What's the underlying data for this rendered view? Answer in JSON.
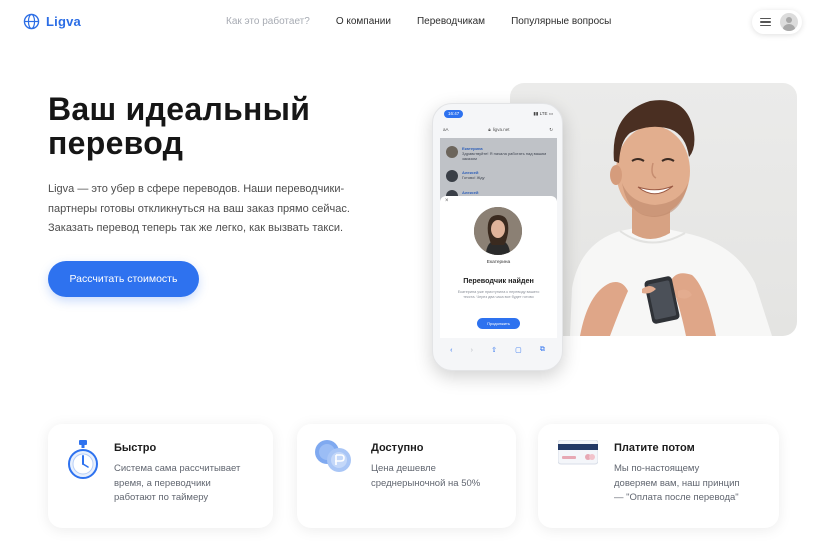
{
  "header": {
    "brand": "Ligva",
    "nav": [
      {
        "label": "Как это работает?",
        "muted": true
      },
      {
        "label": "О компании",
        "muted": false
      },
      {
        "label": "Переводчикам",
        "muted": false
      },
      {
        "label": "Популярные вопросы",
        "muted": false
      }
    ]
  },
  "hero": {
    "title_line1": "Ваш идеальный",
    "title_line2": "перевод",
    "desc_lines": [
      "Ligva — это убер в сфере переводов. Наши переводчики-",
      "партнеры готовы откликнуться на ваш заказ прямо сейчас.",
      "Заказать перевод теперь так же легко, как вызвать такси."
    ],
    "cta": "Рассчитать стоимость"
  },
  "phone": {
    "time": "16:47",
    "status_icons": "▮▮ LTE ▭",
    "url_left": "aA",
    "url": "ligva.net",
    "chats": [
      {
        "name": "Екатерина",
        "text": "Здравствуйте! Я начала работать над вашим заказом"
      },
      {
        "name": "Алексей",
        "text": "Готово! Жду"
      },
      {
        "name": "Алексей",
        "text": ""
      }
    ],
    "close": "×",
    "translator_name": "Екатерина",
    "found_title": "Переводчик найден",
    "found_desc": "Екатерина уже приступила к переводу вашего текста. Через два часа все будет готово",
    "continue_btn": "Продолжить",
    "bottom_icons": [
      "‹",
      "›",
      "⇧",
      "▢",
      "⧉"
    ]
  },
  "features": [
    {
      "title": "Быстро",
      "lines": [
        "Система сама рассчитывает",
        "время, а переводчики",
        "работают по таймеру"
      ],
      "icon": "stopwatch-icon"
    },
    {
      "title": "Доступно",
      "lines": [
        "Цена дешевле",
        "среднерыночной на 50%"
      ],
      "icon": "coins-icon"
    },
    {
      "title": "Платите потом",
      "lines": [
        "Мы по-настоящему",
        "доверяем вам, наш принцип",
        "— \"Оплата после перевода\""
      ],
      "icon": "credit-card-icon"
    }
  ],
  "colors": {
    "accent": "#2e72ef",
    "brand": "#2b6de5"
  }
}
